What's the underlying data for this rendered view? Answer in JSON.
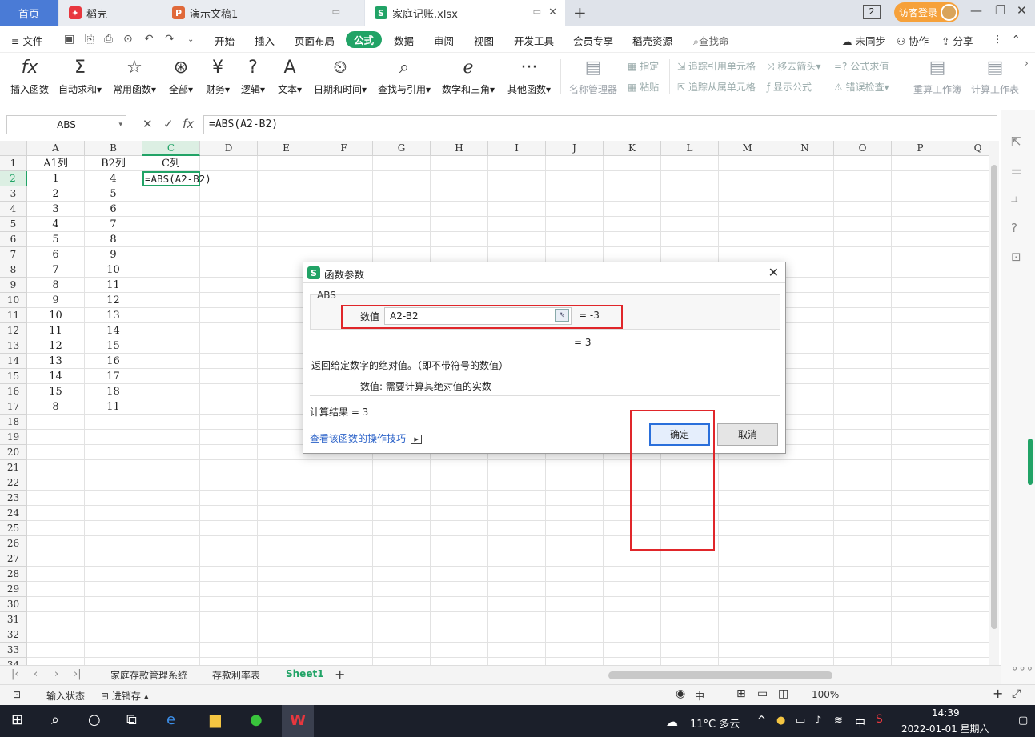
{
  "window_tabs": [
    {
      "label": "首页"
    },
    {
      "label": "稻壳"
    },
    {
      "label": "演示文稿1"
    },
    {
      "label": "家庭记账.xlsx"
    }
  ],
  "title_right": {
    "window_count": "2",
    "login_label": "访客登录"
  },
  "menubar": {
    "file": "文件",
    "tabs": [
      "开始",
      "插入",
      "页面布局",
      "公式",
      "数据",
      "审阅",
      "视图",
      "开发工具",
      "会员专享",
      "稻壳资源"
    ],
    "active_tab": "公式",
    "search": "查找命",
    "sync": "未同步",
    "collab": "协作",
    "share": "分享"
  },
  "ribbon": {
    "insert_function": "插入函数",
    "autosum": "自动求和",
    "common": "常用函数",
    "all": "全部",
    "finance": "财务",
    "logic": "逻辑",
    "text": "文本",
    "datetime": "日期和时间",
    "lookup": "查找与引用",
    "math": "数学和三角",
    "other": "其他函数",
    "name_manager": "名称管理器",
    "define": "指定",
    "paste": "粘贴",
    "trace_precedents": "追踪引用单元格",
    "trace_dependents": "追踪从属单元格",
    "remove_arrows": "移去箭头",
    "show_formulas": "显示公式",
    "eval_formula": "公式求值",
    "error_check": "错误检查",
    "recalc_workbook": "重算工作簿",
    "calc_sheet": "计算工作表"
  },
  "formula_bar": {
    "name_box": "ABS",
    "formula": "=ABS(A2-B2)"
  },
  "grid": {
    "columns": [
      "A",
      "B",
      "C",
      "D",
      "E",
      "F",
      "G",
      "H",
      "I",
      "J",
      "K",
      "L",
      "M",
      "N",
      "O",
      "P",
      "Q"
    ],
    "rows": [
      "1",
      "2",
      "3",
      "4",
      "5",
      "6",
      "7",
      "8",
      "9",
      "10",
      "11",
      "12",
      "13",
      "14",
      "15",
      "16",
      "17",
      "18",
      "19",
      "20",
      "21",
      "22",
      "23",
      "24",
      "25",
      "26",
      "27",
      "28",
      "29",
      "30",
      "31",
      "32",
      "33",
      "34"
    ],
    "selected_row": "2",
    "selected_col": "C",
    "active_cell_text": "=ABS(A2-B2)",
    "colA": [
      "A1列",
      "1",
      "2",
      "3",
      "4",
      "5",
      "6",
      "7",
      "8",
      "9",
      "10",
      "11",
      "12",
      "13",
      "14",
      "15",
      "8"
    ],
    "colB": [
      "B2列",
      "4",
      "5",
      "6",
      "7",
      "8",
      "9",
      "10",
      "11",
      "12",
      "13",
      "14",
      "15",
      "16",
      "17",
      "18",
      "11"
    ],
    "colC": [
      "C列"
    ]
  },
  "dialog": {
    "title": "函数参数",
    "function_name": "ABS",
    "arg_label": "数值",
    "arg_value": "A2-B2",
    "arg_result": "= -3",
    "function_result": "= 3",
    "description": "返回给定数字的绝对值。（即不带符号的数值）",
    "param_description": "数值:  需要计算其绝对值的实数",
    "calc_result": "计算结果  =  3",
    "tip_link": "查看该函数的操作技巧",
    "ok": "确定",
    "cancel": "取消"
  },
  "sheets": {
    "tabs": [
      "家庭存款管理系统",
      "存款利率表",
      "Sheet1"
    ],
    "active": "Sheet1"
  },
  "statusbar": {
    "input_state": "输入状态",
    "jinxiaocun": "进销存",
    "lang": "中",
    "zoom": "100%"
  },
  "taskbar": {
    "weather": "11°C  多云",
    "ime": "中",
    "time": "14:39",
    "date": "2022-01-01 星期六"
  },
  "colors": {
    "accent": "#21a366",
    "annotation": "#e0262a",
    "home_tab": "#4a7bd6"
  }
}
